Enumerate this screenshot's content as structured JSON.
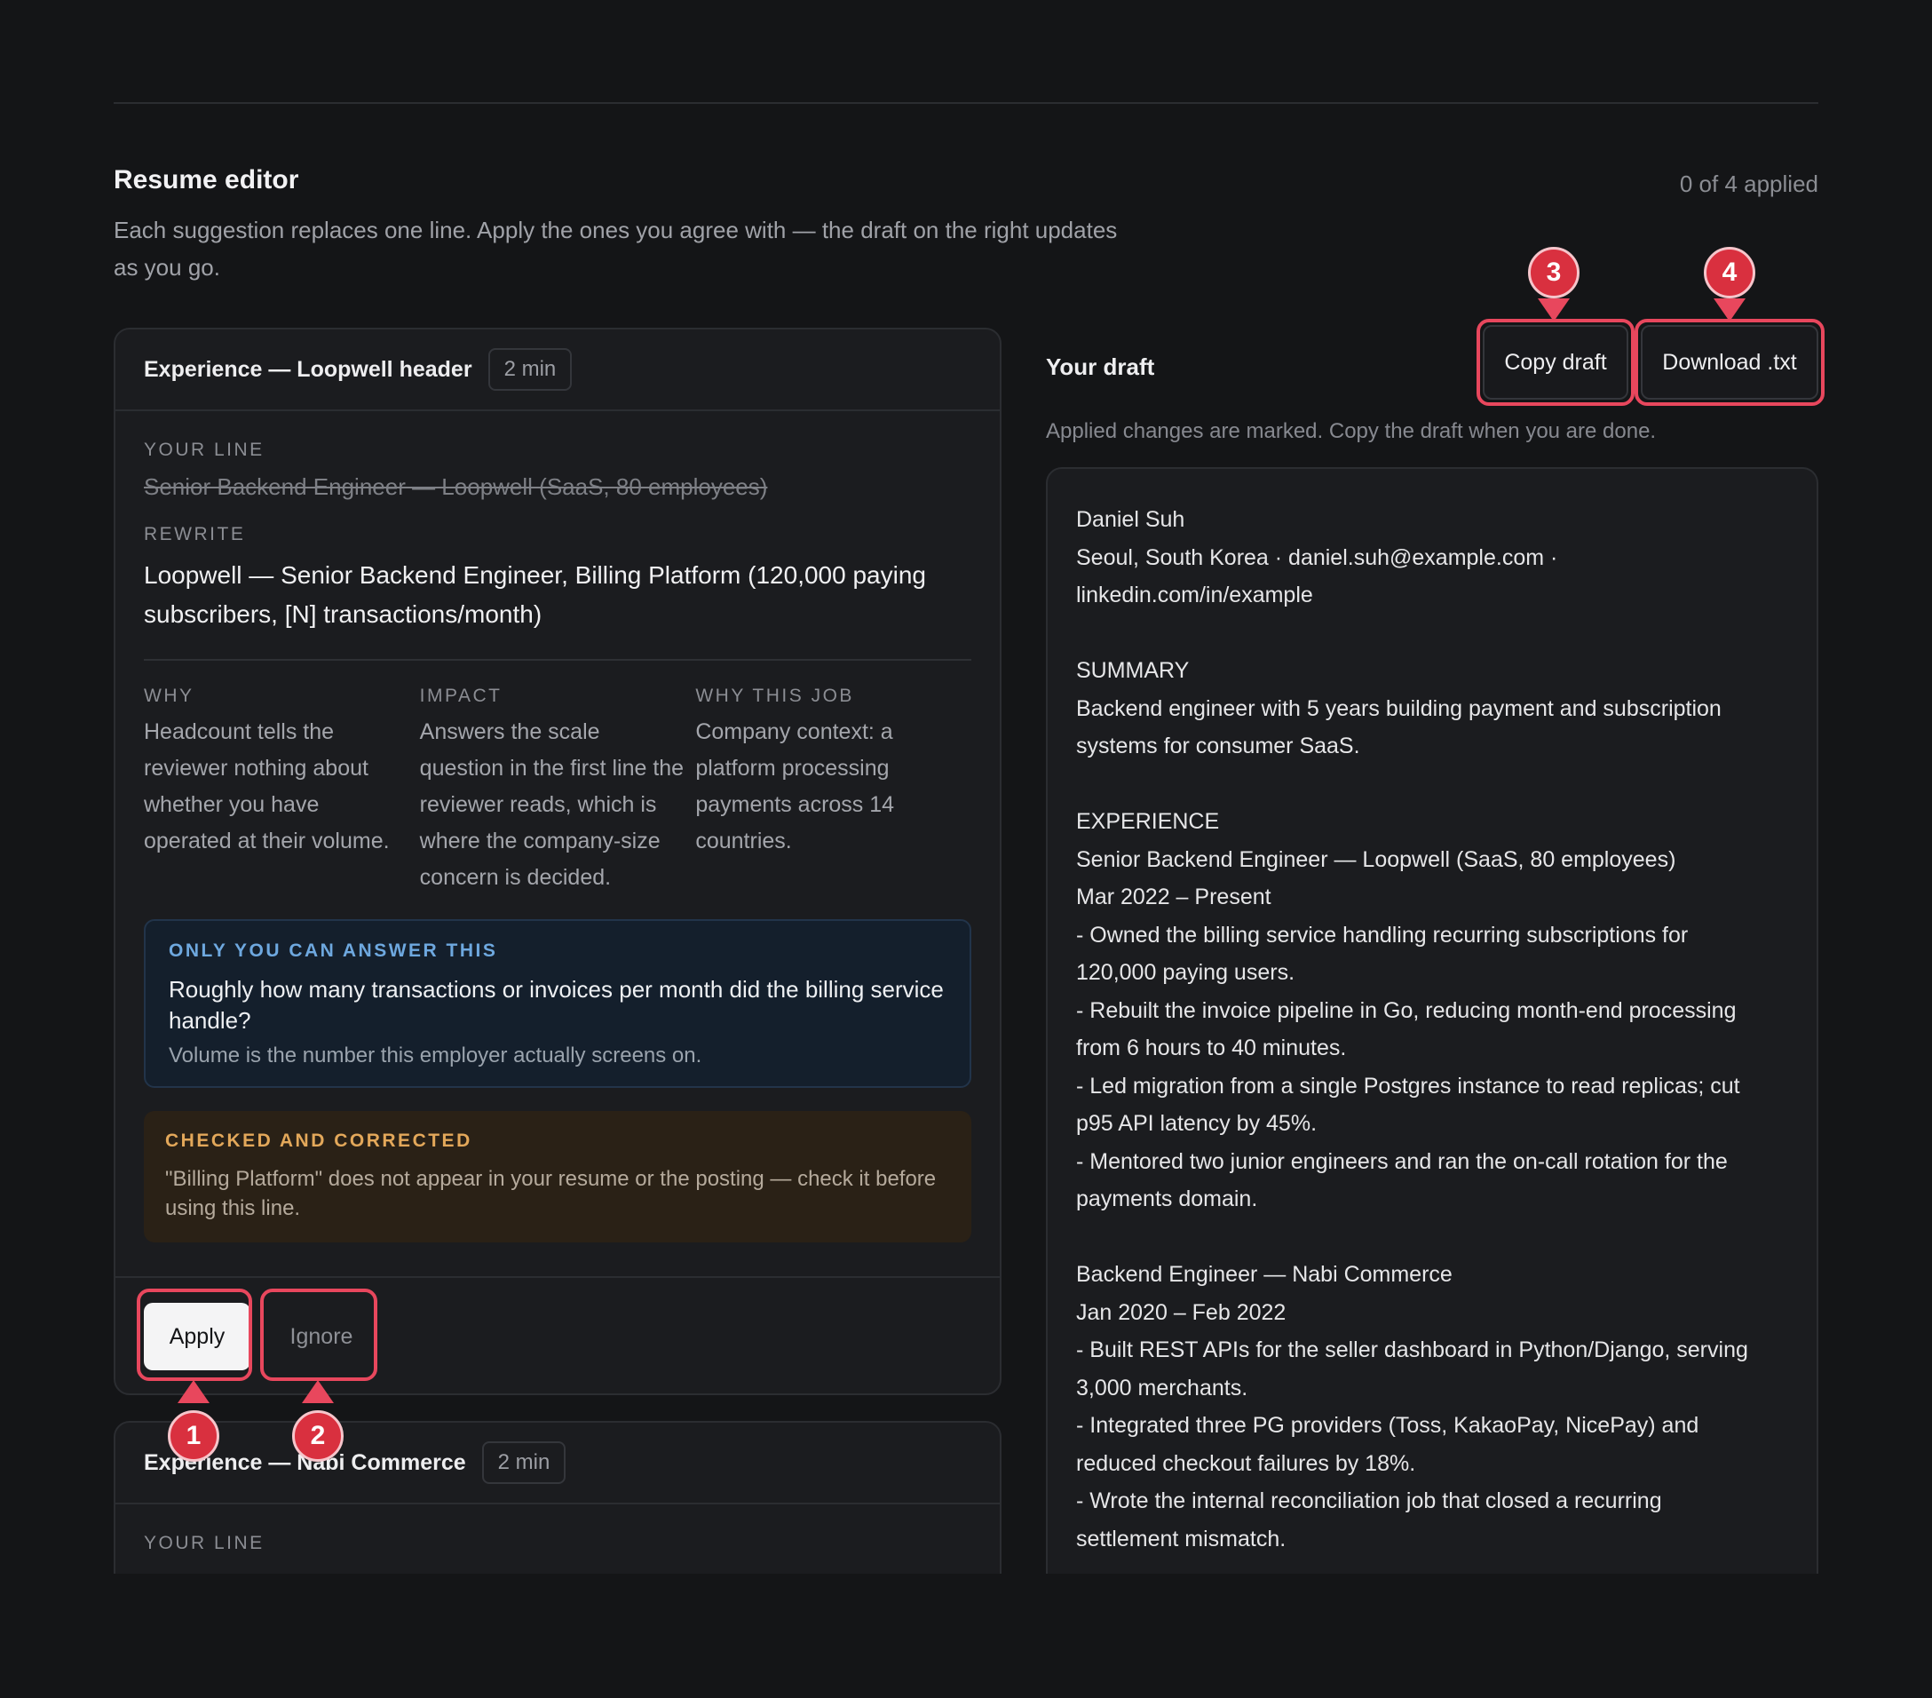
{
  "header": {
    "title": "Resume editor",
    "subtitle": "Each suggestion replaces one line. Apply the ones you agree with — the draft on the right updates as you go.",
    "applied_count": "0 of 4 applied"
  },
  "suggestions": [
    {
      "heading": "Experience — Loopwell header",
      "time": "2 min",
      "your_line_label": "YOUR LINE",
      "your_line": "Senior Backend Engineer — Loopwell (SaaS, 80 employees)",
      "rewrite_label": "REWRITE",
      "rewrite": "Loopwell — Senior Backend Engineer, Billing Platform (120,000 paying subscribers, [N] transactions/month)",
      "why_label": "WHY",
      "why": "Headcount tells the reviewer nothing about whether you have operated at their volume.",
      "impact_label": "IMPACT",
      "impact": "Answers the scale question in the first line the reviewer reads, which is where the company-size concern is decided.",
      "why_job_label": "WHY THIS JOB",
      "why_job": "Company context: a platform processing payments across 14 countries.",
      "question_label": "ONLY YOU CAN ANSWER THIS",
      "question": "Roughly how many transactions or invoices per month did the billing service handle?",
      "question_note": "Volume is the number this employer actually screens on.",
      "check_label": "CHECKED AND CORRECTED",
      "check_text": "\"Billing Platform\" does not appear in your resume or the posting — check it before using this line.",
      "apply_label": "Apply",
      "ignore_label": "Ignore"
    },
    {
      "heading": "Experience — Nabi Commerce",
      "time": "2 min",
      "your_line_label": "YOUR LINE"
    }
  ],
  "draft": {
    "title": "Your draft",
    "copy_label": "Copy draft",
    "download_label": "Download .txt",
    "note": "Applied changes are marked. Copy the draft when you are done.",
    "lines": [
      "Daniel Suh",
      "Seoul, South Korea · daniel.suh@example.com ·",
      "linkedin.com/in/example",
      "",
      "SUMMARY",
      "Backend engineer with 5 years building payment and subscription",
      "systems for consumer SaaS.",
      "",
      "EXPERIENCE",
      "Senior Backend Engineer — Loopwell (SaaS, 80 employees)",
      "Mar 2022 – Present",
      "- Owned the billing service handling recurring subscriptions for",
      "120,000 paying users.",
      "- Rebuilt the invoice pipeline in Go, reducing month-end processing",
      "from 6 hours to 40 minutes.",
      "- Led migration from a single Postgres instance to read replicas; cut",
      "p95 API latency by 45%.",
      "- Mentored two junior engineers and ran the on-call rotation for the",
      "payments domain.",
      "",
      "Backend Engineer — Nabi Commerce",
      "Jan 2020 – Feb 2022",
      "- Built REST APIs for the seller dashboard in Python/Django, serving",
      "3,000 merchants.",
      "- Integrated three PG providers (Toss, KakaoPay, NicePay) and",
      "reduced checkout failures by 18%.",
      "- Wrote the internal reconciliation job that closed a recurring",
      "settlement mismatch."
    ]
  },
  "annotations": {
    "badges": [
      "1",
      "2",
      "3",
      "4"
    ],
    "color": "#e8475d"
  }
}
